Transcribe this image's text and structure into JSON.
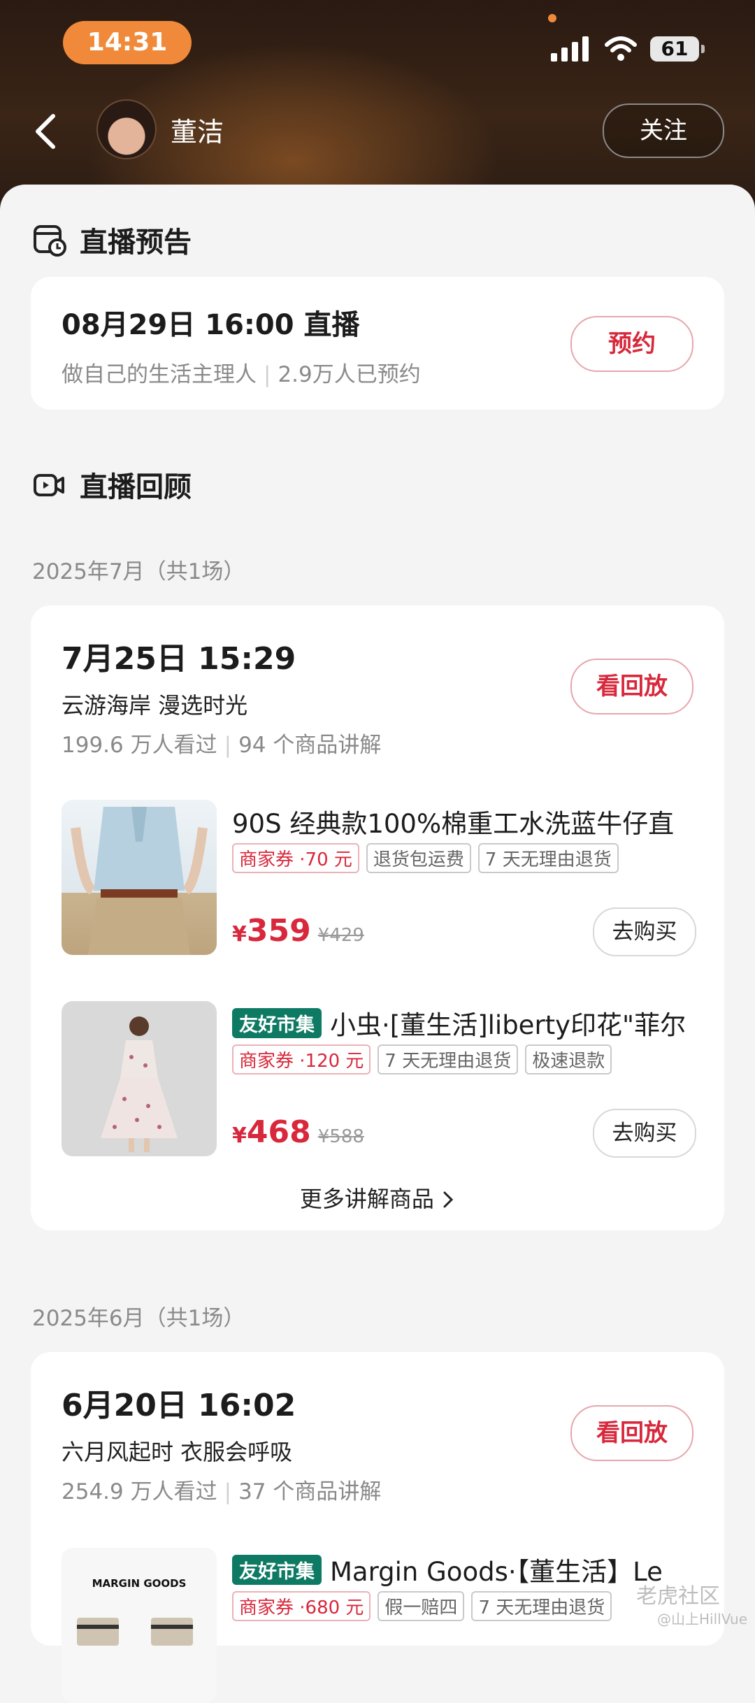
{
  "status_bar": {
    "time": "14:31",
    "battery": "61"
  },
  "header": {
    "username": "董洁",
    "follow_label": "关注"
  },
  "preview": {
    "section_title": "直播预告",
    "datetime": "08月29日 16:00 直播",
    "subtitle": "做自己的生活主理人",
    "reservations": "2.9万人已预约",
    "reserve_label": "预约"
  },
  "replay": {
    "section_title": "直播回顾",
    "groups": [
      {
        "month": "2025年7月（共1场）",
        "date": "7月25日 15:29",
        "title": "云游海岸  漫选时光",
        "viewers": "199.6 万人看过",
        "products_count": "94 个商品讲解",
        "replay_label": "看回放",
        "products": [
          {
            "name": "90S 经典款100%棉重工水洗蓝牛仔直",
            "badge": "",
            "tags": [
              "商家券 ·70 元",
              "退货包运费",
              "7 天无理由退货"
            ],
            "price": "359",
            "old_price": "¥429",
            "buy_label": "去购买"
          },
          {
            "name": "小虫·[董生活]liberty印花\"菲尔",
            "badge": "友好市集",
            "tags": [
              "商家券 ·120 元",
              "7 天无理由退货",
              "极速退款"
            ],
            "price": "468",
            "old_price": "¥588",
            "buy_label": "去购买"
          }
        ],
        "more_label": "更多讲解商品"
      },
      {
        "month": "2025年6月（共1场）",
        "date": "6月20日 16:02",
        "title": "六月风起时  衣服会呼吸",
        "viewers": "254.9 万人看过",
        "products_count": "37 个商品讲解",
        "replay_label": "看回放",
        "products": [
          {
            "name": "Margin Goods·【董生活】Le",
            "badge": "友好市集",
            "image_text": "MARGIN GOODS",
            "tags": [
              "商家券 ·680 元",
              "假一赔四",
              "7 天无理由退货"
            ]
          }
        ]
      }
    ]
  },
  "currency_symbol": "¥",
  "watermark": {
    "brand": "老虎社区",
    "handle": "@山上HillVue"
  }
}
